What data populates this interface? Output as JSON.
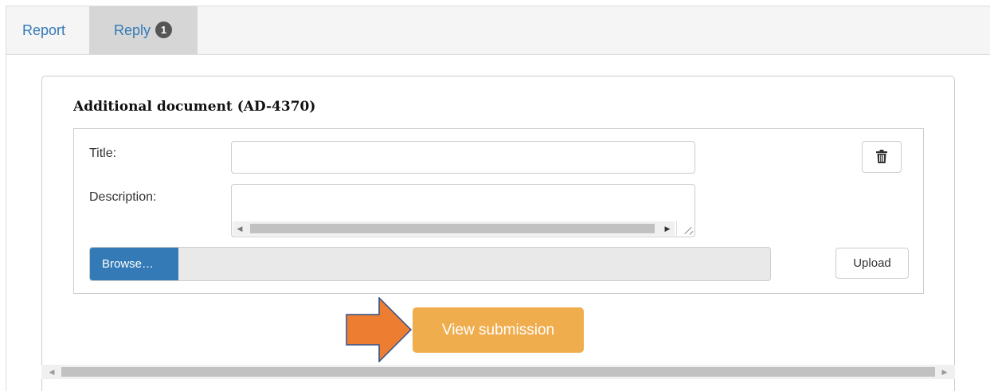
{
  "tabs": [
    {
      "label": "Report"
    },
    {
      "label": "Reply",
      "badge": "1"
    }
  ],
  "document": {
    "title": "Additional document (AD-4370)",
    "fields": {
      "title_label": "Title:",
      "title_value": "",
      "description_label": "Description:",
      "description_value": ""
    },
    "browse_label": "Browse…",
    "upload_label": "Upload"
  },
  "actions": {
    "view_submission_label": "View submission"
  },
  "colors": {
    "primary": "#337ab7",
    "warning": "#f0ad4e",
    "arrow": "#ed7d31"
  },
  "icons": {
    "delete": "trash-icon",
    "pointer": "arrow-right-icon"
  }
}
